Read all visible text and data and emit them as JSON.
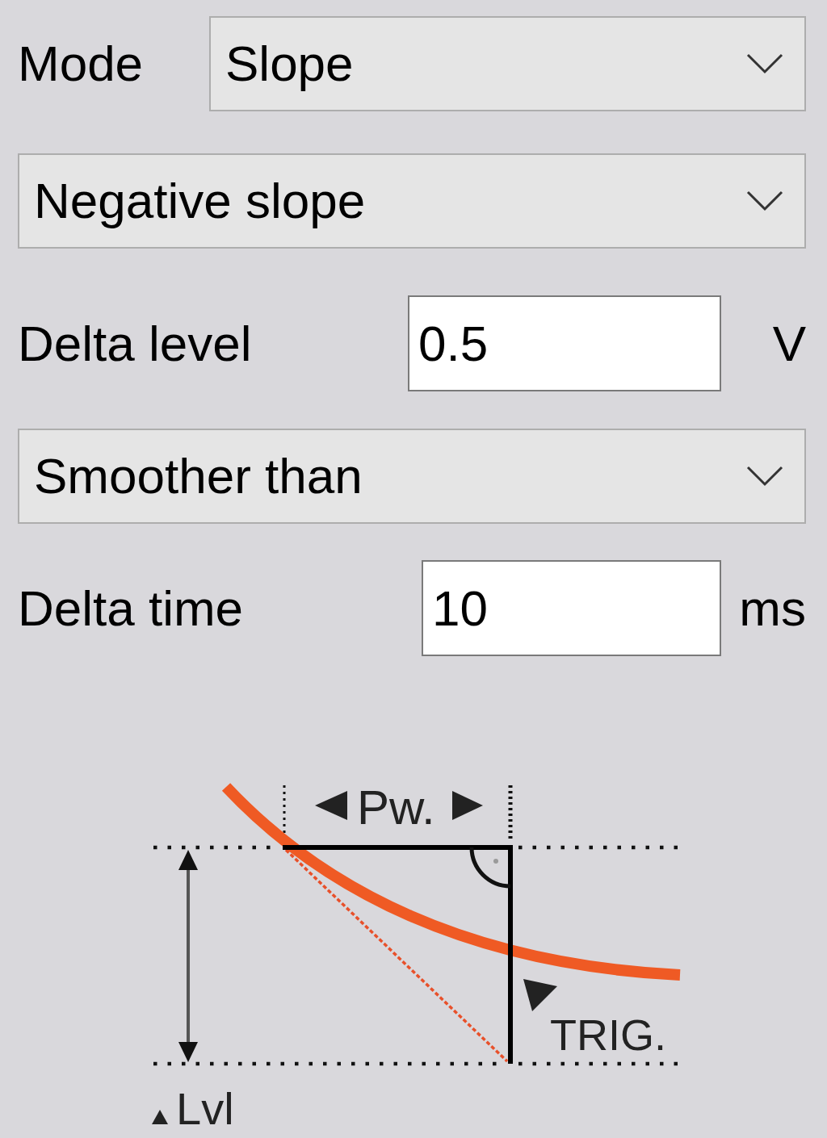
{
  "fields": [
    {
      "kind": "select",
      "label": "Mode",
      "value": "Slope"
    },
    {
      "kind": "select",
      "value": "Negative slope"
    },
    {
      "kind": "input",
      "label": "Delta level",
      "value": "0.5",
      "unit": "V"
    },
    {
      "kind": "select",
      "value": "Smoother than"
    },
    {
      "kind": "input",
      "label": "Delta time",
      "value": "10",
      "unit": "ms"
    }
  ],
  "diagram": {
    "pulse_width_label": "Pw.",
    "trigger_label": "TRIG.",
    "level_label": "Lvl"
  }
}
